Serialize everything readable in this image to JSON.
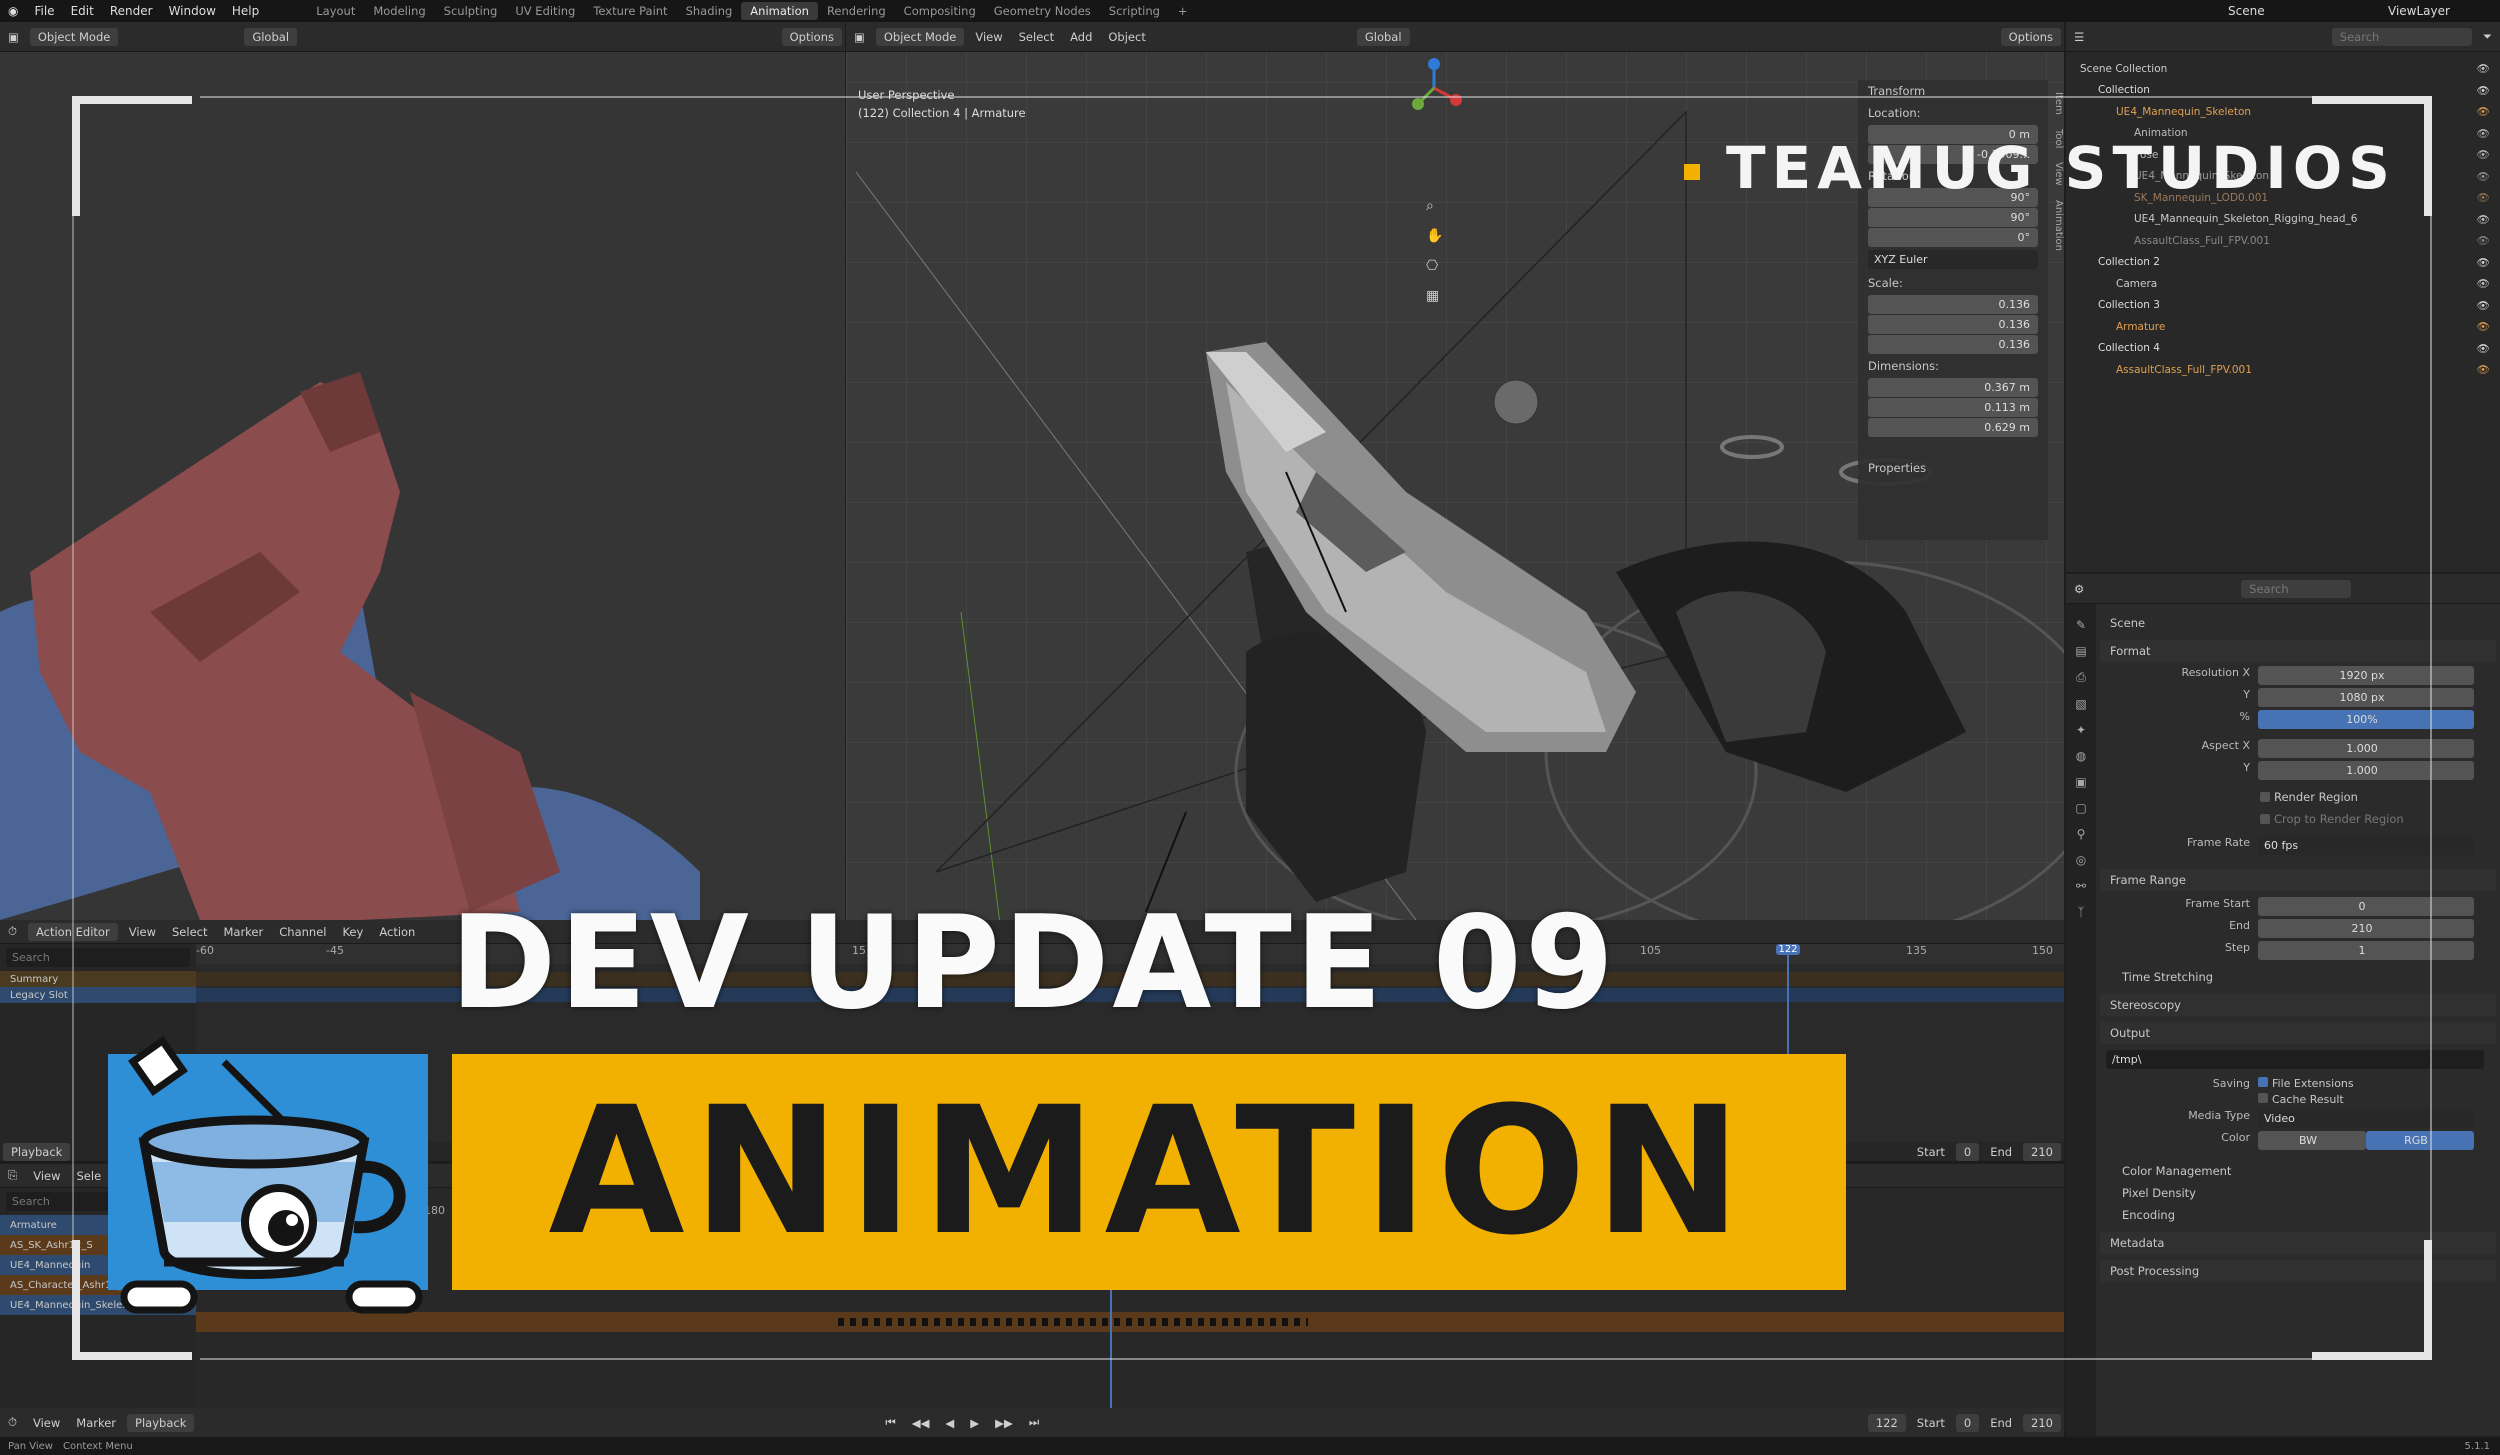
{
  "topbar": {
    "menus": [
      "File",
      "Edit",
      "Render",
      "Window",
      "Help"
    ],
    "workspaces": [
      "Layout",
      "Modeling",
      "Sculpting",
      "UV Editing",
      "Texture Paint",
      "Shading",
      "Animation",
      "Rendering",
      "Compositing",
      "Geometry Nodes",
      "Scripting"
    ],
    "active_workspace": "Animation",
    "scene": "Scene",
    "view_layer": "ViewLayer"
  },
  "left_view": {
    "mode": "Object Mode",
    "orientation": "Global",
    "options": "Options"
  },
  "main_view": {
    "mode": "Object Mode",
    "menus": [
      "View",
      "Select",
      "Add",
      "Object"
    ],
    "orientation": "Global",
    "options": "Options",
    "perspective": "User Perspective",
    "collection": "(122) Collection 4 | Armature"
  },
  "n_panel": {
    "title": "Transform",
    "location": "Location:",
    "loc_x": "0 m",
    "loc_y": "-0.1909...",
    "rotation": "Rotation:",
    "rot_x": "90°",
    "rot_y": "90°",
    "rot_z": "0°",
    "rot_mode": "XYZ Euler",
    "scale": "Scale:",
    "sc_x": "0.136",
    "sc_y": "0.136",
    "sc_z": "0.136",
    "dimensions": "Dimensions:",
    "dim_x": "0.367 m",
    "dim_y": "0.113 m",
    "dim_z": "0.629 m",
    "properties": "Properties",
    "tabs": [
      "Item",
      "Tool",
      "View",
      "Animation"
    ]
  },
  "outliner": {
    "search": "Search",
    "items": [
      "Scene Collection",
      "Collection",
      "UE4_Mannequin_Skeleton",
      "Animation",
      "Pose",
      "UE4_Mannequin_Skeleton",
      "SK_Mannequin_LOD0.001",
      "UE4_Mannequin_Skeleton_Rigging_head_6",
      "AssaultClass_Full_FPV.001",
      "Collection 2",
      "Camera",
      "Collection 3",
      "Armature",
      "Collection 4",
      "AssaultClass_Full_FPV.001"
    ]
  },
  "props": {
    "search": "Search",
    "scene": "Scene",
    "format": "Format",
    "res_x_label": "Resolution X",
    "res_x": "1920 px",
    "y_label": "Y",
    "res_y": "1080 px",
    "pct_label": "%",
    "pct": "100%",
    "aspect_x_label": "Aspect X",
    "aspect_x": "1.000",
    "aspect_y": "1.000",
    "render_region": "Render Region",
    "crop": "Crop to Render Region",
    "frame_rate_label": "Frame Rate",
    "frame_rate": "60 fps",
    "frame_range": "Frame Range",
    "frame_start_label": "Frame Start",
    "frame_start": "0",
    "end_label": "End",
    "end": "210",
    "step_label": "Step",
    "step": "1",
    "time_stretching": "Time Stretching",
    "stereoscopy": "Stereoscopy",
    "output": "Output",
    "path": "/tmp\\",
    "saving": "Saving",
    "file_ext": "File Extensions",
    "cache": "Cache Result",
    "media_type_label": "Media Type",
    "media_type": "Video",
    "color_label": "Color",
    "bw": "BW",
    "rgb": "RGB",
    "color_mgmt": "Color Management",
    "pixel_density": "Pixel Density",
    "encoding": "Encoding",
    "metadata": "Metadata",
    "post_processing": "Post Processing"
  },
  "action_editor": {
    "mode": "Action Editor",
    "menus": [
      "View",
      "Select",
      "Marker",
      "Channel",
      "Key",
      "Action"
    ],
    "search": "Search",
    "summary": "Summary",
    "slot": "Legacy Slot",
    "ticks": [
      "-60",
      "-45",
      "15",
      "105",
      "122",
      "135",
      "150"
    ],
    "current": "122"
  },
  "playback_bar": {
    "playback": "Playback",
    "start_label": "Start",
    "start": "0",
    "end_label": "End",
    "end": "210"
  },
  "nla": {
    "menus": [
      "View",
      "Sele"
    ],
    "search": "Search",
    "rows": [
      "Armature",
      "AS_SK_Ashr12_S",
      "UE4_Mannequin",
      "AS_Character_Ashr12_Re",
      "UE4_Mannequin_Skeleton"
    ],
    "tick": "180"
  },
  "timeline": {
    "menus": [
      "View",
      "Marker",
      "Playback"
    ],
    "frame": "122",
    "start_label": "Start",
    "start": "0",
    "end_label": "End",
    "end": "210"
  },
  "status": {
    "pan": "Pan View",
    "context": "Context Menu",
    "version": "5.1.1"
  },
  "overlay": {
    "studio": "TEAMUG STUDIOS",
    "headline": "DEV UPDATE 09",
    "banner": "ANIMATION"
  },
  "colors": {
    "accent": "#f2b100",
    "blue": "#2f8fd6",
    "dark": "#1b1b1b"
  }
}
